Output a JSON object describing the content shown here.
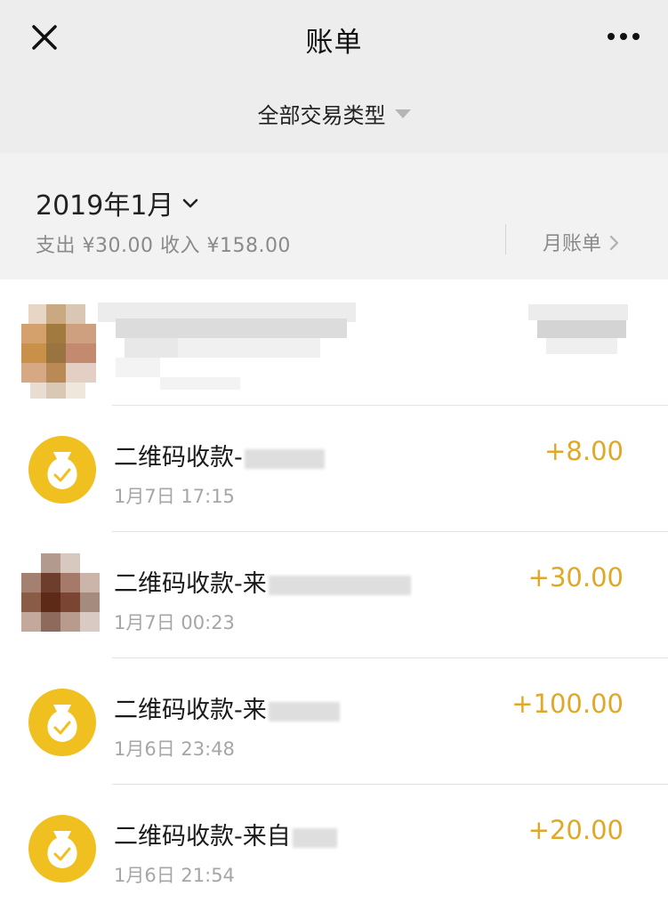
{
  "header": {
    "title": "账单",
    "filter_label": "全部交易类型"
  },
  "summary": {
    "month_label": "2019年1月",
    "totals_text": "支出 ¥30.00 收入 ¥158.00",
    "monthly_bill_label": "月账单"
  },
  "transactions": [
    {
      "name": "",
      "time": "",
      "amount": "",
      "icon": "blurred-avatar"
    },
    {
      "name": "二维码收款-",
      "time": "1月7日 17:15",
      "amount": "+8.00",
      "icon": "money-bag-icon"
    },
    {
      "name": "二维码收款-来",
      "time": "1月7日 00:23",
      "amount": "+30.00",
      "icon": "blurred-avatar"
    },
    {
      "name": "二维码收款-来",
      "time": "1月6日 23:48",
      "amount": "+100.00",
      "icon": "money-bag-icon"
    },
    {
      "name": "二维码收款-来自",
      "time": "1月6日 21:54",
      "amount": "+20.00",
      "icon": "money-bag-icon"
    }
  ],
  "colors": {
    "header_bg": "#ededed",
    "summary_bg": "#f2f2f2",
    "income_amount": "#e0a828",
    "coin_icon": "#f0c020"
  }
}
